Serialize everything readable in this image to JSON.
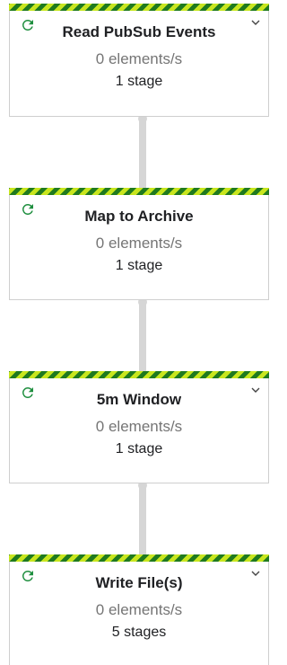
{
  "colors": {
    "stripe_dark": "#1f7a1f",
    "stripe_light": "#c8e61e",
    "status_icon": "#1e8e3e",
    "connector": "#d6d6d6",
    "rate_text": "#757575"
  },
  "icons": {
    "status": "refresh-running-icon",
    "expand": "chevron-down-icon"
  },
  "nodes": [
    {
      "title": "Read PubSub Events",
      "rate": "0 elements/s",
      "stages": "1 stage"
    },
    {
      "title": "Map to Archive",
      "rate": "0 elements/s",
      "stages": "1 stage"
    },
    {
      "title": "5m Window",
      "rate": "0 elements/s",
      "stages": "1 stage"
    },
    {
      "title": "Write File(s)",
      "rate": "0 elements/s",
      "stages": "5 stages"
    }
  ]
}
